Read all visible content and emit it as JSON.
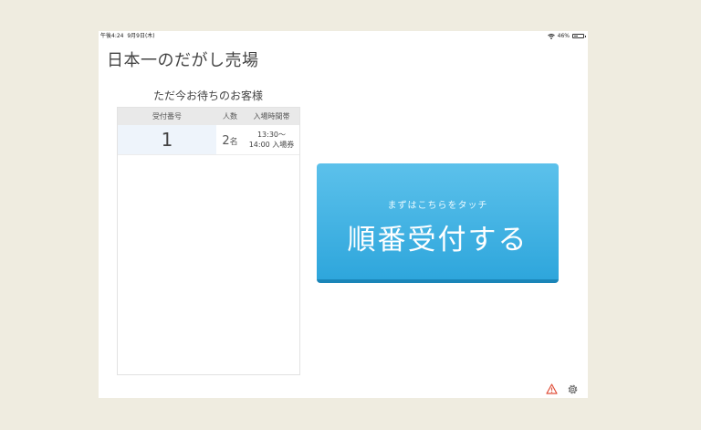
{
  "status_bar": {
    "time": "午後4:24",
    "date": "9月9日(木)",
    "battery": "46%",
    "battery_level": 0.46
  },
  "app": {
    "title": "日本一のだがし売場"
  },
  "queue": {
    "heading": "ただ今お待ちのお客様",
    "columns": [
      "受付番号",
      "人数",
      "入場時間帯"
    ],
    "rows": [
      {
        "number": "1",
        "people": "2",
        "people_unit": "名",
        "time_line1": "13:30〜",
        "time_line2": "14:00 入場券"
      }
    ]
  },
  "touch_button": {
    "subtitle": "まずはこちらをタッチ",
    "label": "順番受付する"
  },
  "icons": {
    "warning": "warning-icon",
    "settings": "gear-icon"
  },
  "colors": {
    "button_top": "#5cc1eb",
    "button_bottom": "#2ea6dc",
    "warning": "#e0503a"
  }
}
